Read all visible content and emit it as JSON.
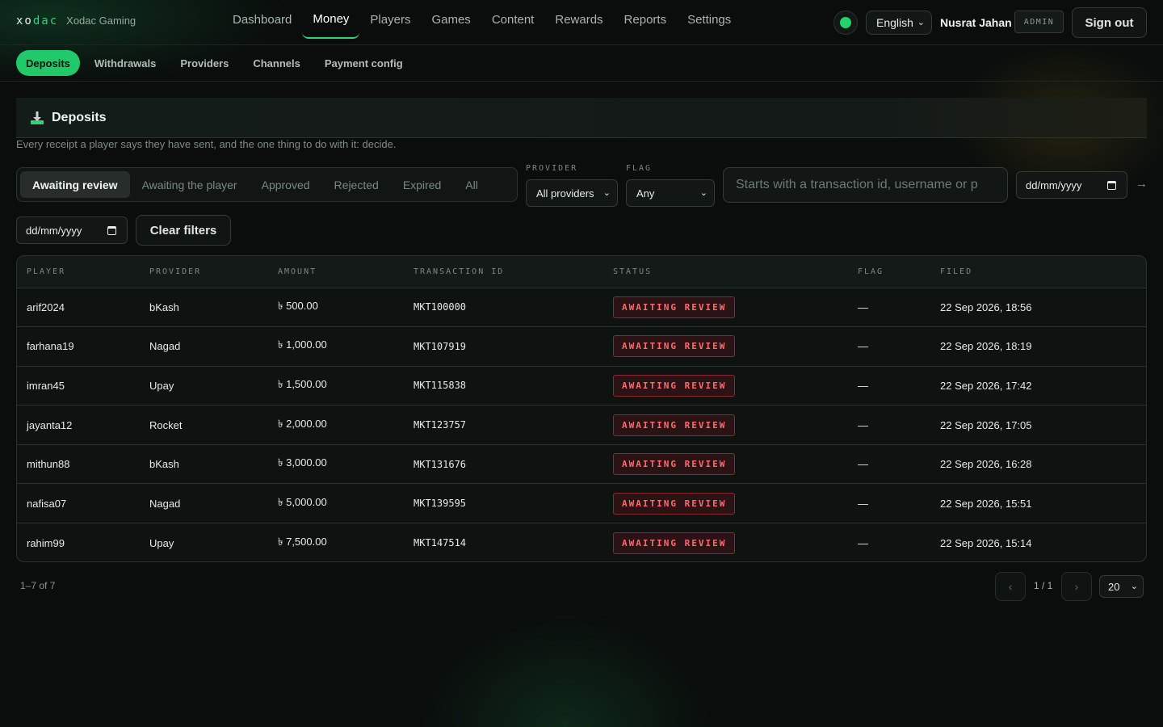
{
  "brand": {
    "logo_prefix": "xo",
    "logo_accent": "dac",
    "name": "Xodac Gaming"
  },
  "nav": {
    "items": [
      {
        "label": "Dashboard"
      },
      {
        "label": "Money",
        "active": true
      },
      {
        "label": "Players"
      },
      {
        "label": "Games"
      },
      {
        "label": "Content"
      },
      {
        "label": "Rewards"
      },
      {
        "label": "Reports"
      },
      {
        "label": "Settings"
      }
    ]
  },
  "header": {
    "language": "English",
    "user_name": "Nusrat Jahan",
    "role": "ADMIN",
    "signout_label": "Sign out"
  },
  "subnav": {
    "items": [
      {
        "label": "Deposits",
        "active": true
      },
      {
        "label": "Withdrawals"
      },
      {
        "label": "Providers"
      },
      {
        "label": "Channels"
      },
      {
        "label": "Payment config"
      }
    ]
  },
  "page": {
    "title": "Deposits",
    "description": "Every receipt a player says they have sent, and the one thing to do with it: decide."
  },
  "filters": {
    "status_tabs": [
      {
        "label": "Awaiting review",
        "active": true
      },
      {
        "label": "Awaiting the player"
      },
      {
        "label": "Approved"
      },
      {
        "label": "Rejected"
      },
      {
        "label": "Expired"
      },
      {
        "label": "All"
      }
    ],
    "provider_label": "PROVIDER",
    "provider_value": "All providers",
    "flag_label": "FLAG",
    "flag_value": "Any",
    "search_placeholder": "Starts with a transaction id, username or p",
    "date_from": "dd/mm/yyyy",
    "date_to": "dd/mm/yyyy",
    "clear_label": "Clear filters"
  },
  "table": {
    "columns": [
      "PLAYER",
      "PROVIDER",
      "AMOUNT",
      "TRANSACTION ID",
      "STATUS",
      "FLAG",
      "FILED"
    ],
    "rows": [
      {
        "player": "arif2024",
        "provider": "bKash",
        "amount": "৳ 500.00",
        "txn": "MKT100000",
        "status": "AWAITING REVIEW",
        "flag": "—",
        "filed": "22 Sep 2026, 18:56"
      },
      {
        "player": "farhana19",
        "provider": "Nagad",
        "amount": "৳ 1,000.00",
        "txn": "MKT107919",
        "status": "AWAITING REVIEW",
        "flag": "—",
        "filed": "22 Sep 2026, 18:19"
      },
      {
        "player": "imran45",
        "provider": "Upay",
        "amount": "৳ 1,500.00",
        "txn": "MKT115838",
        "status": "AWAITING REVIEW",
        "flag": "—",
        "filed": "22 Sep 2026, 17:42"
      },
      {
        "player": "jayanta12",
        "provider": "Rocket",
        "amount": "৳ 2,000.00",
        "txn": "MKT123757",
        "status": "AWAITING REVIEW",
        "flag": "—",
        "filed": "22 Sep 2026, 17:05"
      },
      {
        "player": "mithun88",
        "provider": "bKash",
        "amount": "৳ 3,000.00",
        "txn": "MKT131676",
        "status": "AWAITING REVIEW",
        "flag": "—",
        "filed": "22 Sep 2026, 16:28"
      },
      {
        "player": "nafisa07",
        "provider": "Nagad",
        "amount": "৳ 5,000.00",
        "txn": "MKT139595",
        "status": "AWAITING REVIEW",
        "flag": "—",
        "filed": "22 Sep 2026, 15:51"
      },
      {
        "player": "rahim99",
        "provider": "Upay",
        "amount": "৳ 7,500.00",
        "txn": "MKT147514",
        "status": "AWAITING REVIEW",
        "flag": "—",
        "filed": "22 Sep 2026, 15:14"
      }
    ]
  },
  "pagination": {
    "range": "1–7 of 7",
    "prev_icon": "‹",
    "next_icon": "›",
    "page": "1 / 1",
    "page_size": "20"
  },
  "icons": {
    "status": "online-dot-icon",
    "page": "download-tray-icon",
    "date": "calendar-icon",
    "go": "arrow-right-icon"
  },
  "colors": {
    "accent": "#22c96a",
    "status_danger": "#ff6b6b",
    "background": "#0a0d0c"
  }
}
